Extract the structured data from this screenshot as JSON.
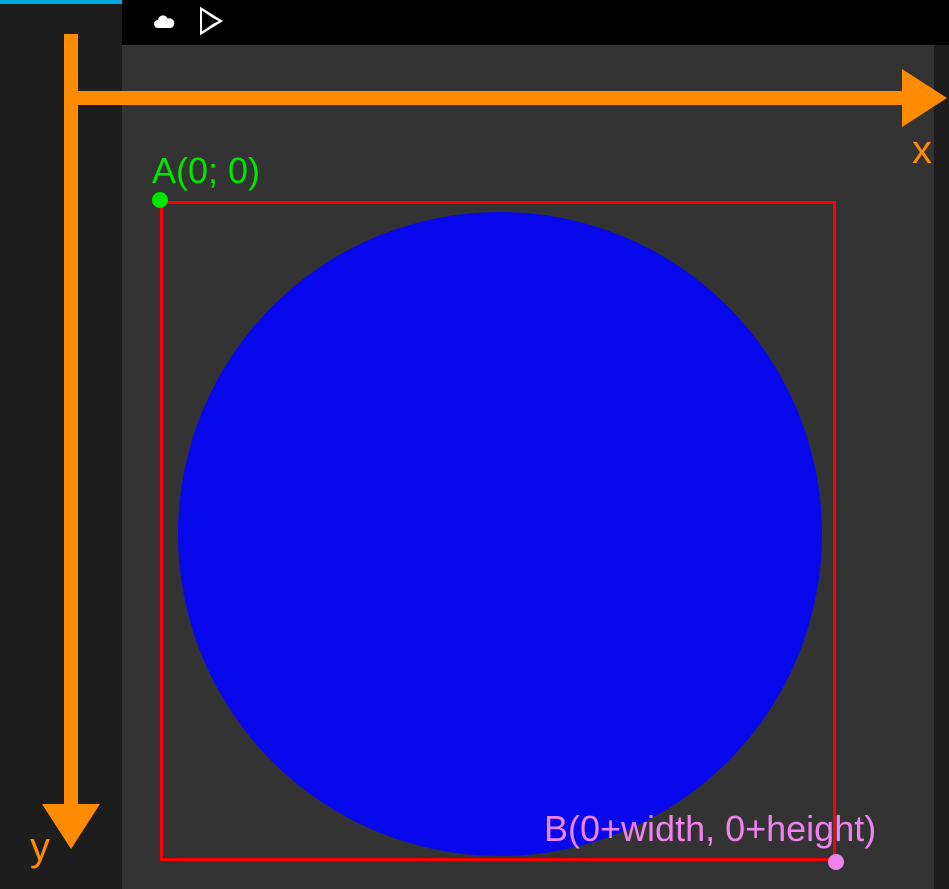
{
  "axes": {
    "x_label": "x",
    "y_label": "y",
    "color": "#ff8c00"
  },
  "points": {
    "a": {
      "label": "A(0; 0)",
      "color": "#00e600"
    },
    "b": {
      "label": "B(0+width, 0+height)",
      "color": "#ee82ee"
    }
  },
  "shapes": {
    "bbox_color": "#ff0000",
    "circle_color": "#0808ec"
  },
  "titlebar": {
    "icon1": "cloud-icon",
    "icon2": "play-store-icon"
  },
  "chart_data": {
    "type": "scatter",
    "title": "",
    "xlabel": "x",
    "ylabel": "y",
    "series": [
      {
        "name": "A",
        "x": [
          0
        ],
        "y": [
          0
        ]
      },
      {
        "name": "B",
        "x": [
          "0+width"
        ],
        "y": [
          "0+height"
        ]
      }
    ],
    "annotations": [
      "Red rectangle bounds oval from A(0;0) to B(0+width,0+height)",
      "Blue oval inscribed in bounding rectangle"
    ]
  }
}
